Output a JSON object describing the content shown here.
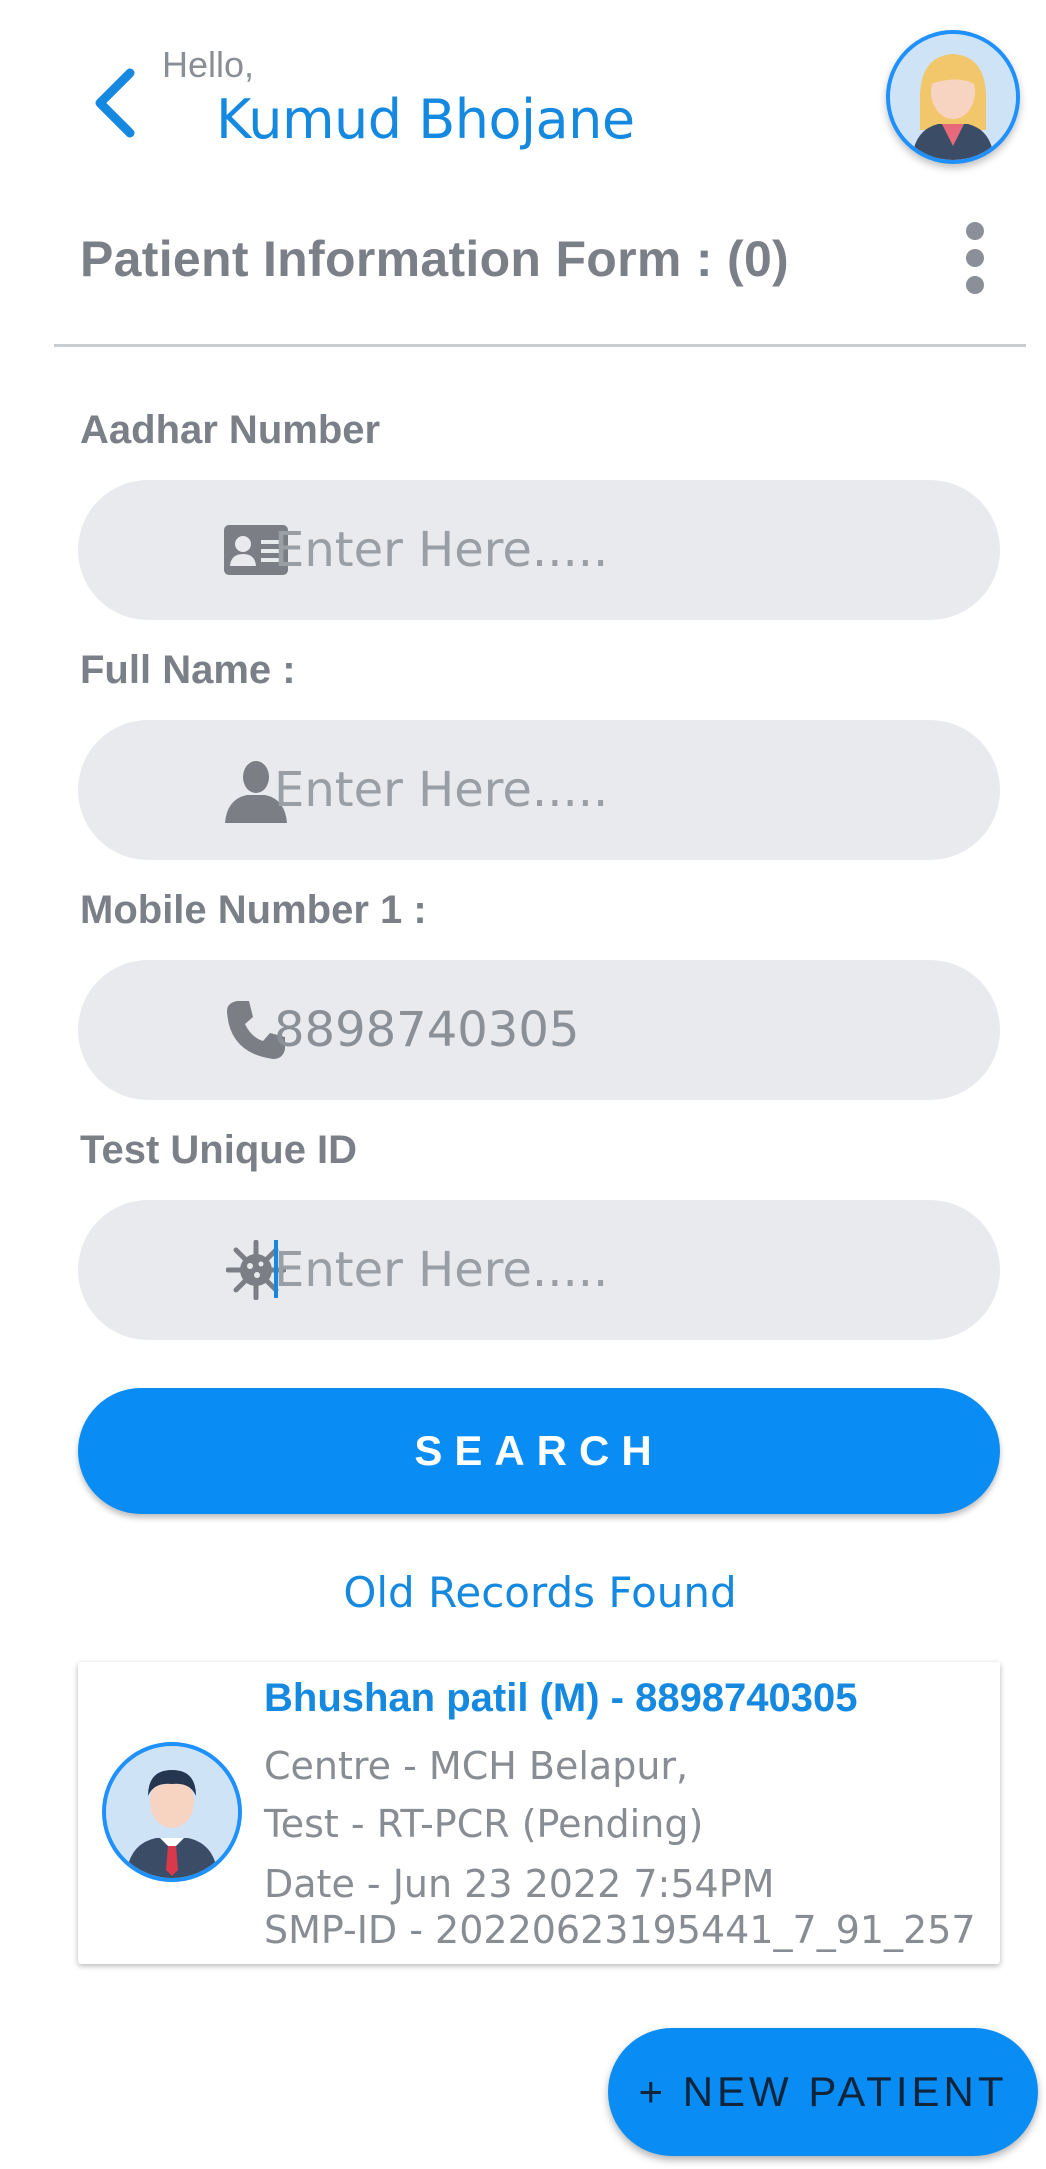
{
  "header": {
    "greeting": "Hello,",
    "user_name": "Kumud Bhojane",
    "form_title": "Patient Information Form : (0)"
  },
  "form": {
    "aadhar": {
      "label": "Aadhar Number",
      "placeholder": "Enter Here.....",
      "value": "",
      "icon": "id-card-icon"
    },
    "full_name": {
      "label": "Full Name :",
      "placeholder": "Enter Here.....",
      "value": "",
      "icon": "person-icon"
    },
    "mobile": {
      "label": "Mobile Number 1 :",
      "placeholder": "Enter Here.....",
      "value": "8898740305",
      "icon": "phone-icon"
    },
    "test_id": {
      "label": "Test Unique ID",
      "placeholder": "Enter Here.....",
      "value": "",
      "icon": "virus-icon"
    },
    "search_label": "SEARCH"
  },
  "records": {
    "heading": "Old Records Found",
    "items": [
      {
        "name": "Bhushan patil (M) - 8898740305",
        "centre": "Centre - MCH Belapur,",
        "test": "Test - RT-PCR (Pending)",
        "date": "Date - Jun 23 2022  7:54PM",
        "smp_id": "SMP-ID - 20220623195441_7_91_257"
      }
    ]
  },
  "actions": {
    "new_patient_label": "+ NEW PATIENT"
  },
  "colors": {
    "accent": "#0a8cf5",
    "title_blue": "#1588e0",
    "field_bg": "#e8eaed"
  }
}
